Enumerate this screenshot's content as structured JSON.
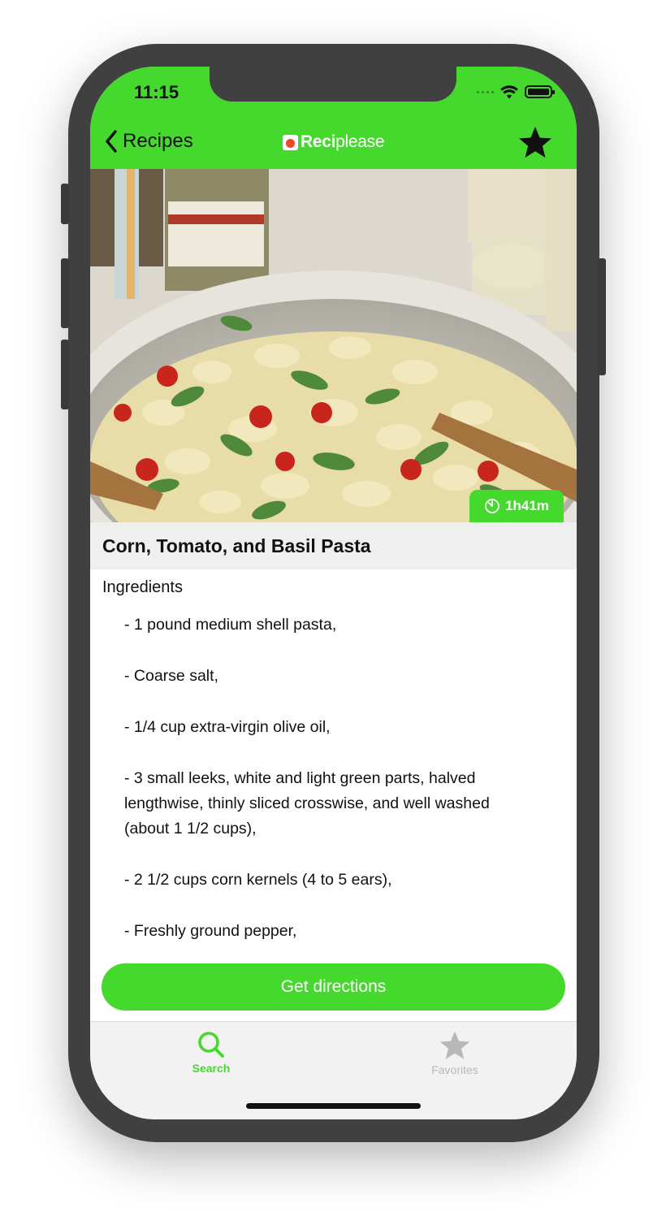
{
  "status_bar": {
    "time": "11:15"
  },
  "nav": {
    "back_label": "Recipes",
    "title_bold": "Reci",
    "title_light": "please",
    "favorite_icon": "star-filled-icon"
  },
  "recipe": {
    "total_time": "1h41m",
    "title": "Corn, Tomato, and Basil Pasta",
    "ingredients_heading": "Ingredients",
    "ingredients": [
      "- 1 pound medium shell pasta,",
      "- Coarse salt,",
      "- 1/4 cup extra-virgin olive oil,",
      "- 3 small leeks, white and light green parts, halved lengthwise, thinly sliced crosswise, and well washed (about 1 1/2 cups),",
      "- 2 1/2 cups corn kernels (4 to 5 ears),",
      "- Freshly ground pepper,"
    ]
  },
  "cta": {
    "label": "Get directions"
  },
  "tabbar": {
    "tabs": [
      {
        "label": "Search",
        "icon": "search-icon",
        "selected": true
      },
      {
        "label": "Favorites",
        "icon": "star-icon",
        "selected": false
      }
    ]
  },
  "colors": {
    "accent": "#45d92d",
    "title_band": "#efefef",
    "tabbar_bg": "#f2f2f2",
    "inactive_tab": "#b8b8b8"
  }
}
